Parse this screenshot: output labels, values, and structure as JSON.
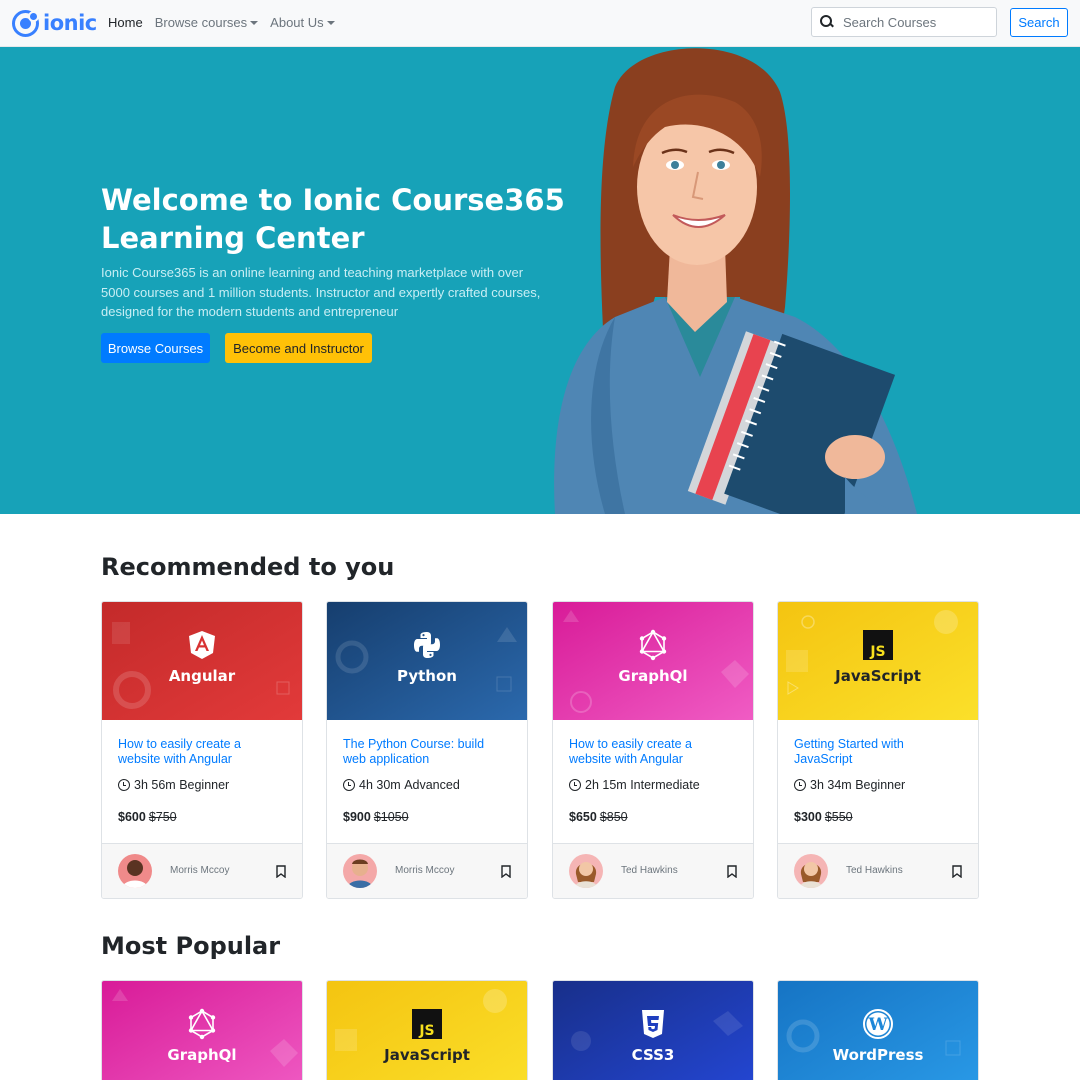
{
  "navbar": {
    "brand": "ionic",
    "links": [
      {
        "label": "Home",
        "active": true,
        "dropdown": false
      },
      {
        "label": "Browse courses",
        "active": false,
        "dropdown": true
      },
      {
        "label": "About Us",
        "active": false,
        "dropdown": true
      }
    ],
    "search": {
      "placeholder": "Search Courses",
      "value": ""
    },
    "search_button": "Search"
  },
  "hero": {
    "title": "Welcome to Ionic Course365 Learning Center",
    "text": "Ionic Course365 is an online learning and teaching marketplace with over 5000 courses and 1 million students. Instructor and expertly crafted courses, designed for the modern students and entrepreneur",
    "primary_button": "Browse Courses",
    "secondary_button": "Become and Instructor",
    "background": "#17a2b8"
  },
  "recommended": {
    "title": "Recommended to you",
    "cards": [
      {
        "image_label": "Angular",
        "icon": "angular-icon",
        "color": "#dd2c2c",
        "title": "How to easily create a website with Angular",
        "duration": "3h 56m",
        "level": "Beginner",
        "price": "$600",
        "old_price": "$750",
        "author": "Morris Mccoy"
      },
      {
        "image_label": "Python",
        "icon": "python-icon",
        "color": "#1e5594",
        "title": "The Python Course: build web application",
        "duration": "4h 30m",
        "level": "Advanced",
        "price": "$900",
        "old_price": "$1050",
        "author": "Morris Mccoy"
      },
      {
        "image_label": "GraphQl",
        "icon": "graphql-icon",
        "color": "#e535ab",
        "title": "How to easily create a website with Angular",
        "duration": "2h 15m",
        "level": "Intermediate",
        "price": "$650",
        "old_price": "$850",
        "author": "Ted Hawkins"
      },
      {
        "image_label": "JavaScript",
        "icon": "js-icon",
        "color": "#f7ce16",
        "title": "Getting Started with JavaScript",
        "duration": "3h 34m",
        "level": "Beginner",
        "price": "$300",
        "old_price": "$550",
        "author": "Ted Hawkins"
      }
    ]
  },
  "popular": {
    "title": "Most Popular",
    "cards": [
      {
        "image_label": "GraphQl",
        "icon": "graphql-icon",
        "color": "#e535ab"
      },
      {
        "image_label": "JavaScript",
        "icon": "js-icon",
        "color": "#f7ce16"
      },
      {
        "image_label": "CSS3",
        "icon": "css3-icon",
        "color": "#1f3fbf"
      },
      {
        "image_label": "WordPress",
        "icon": "wordpress-icon",
        "color": "#1d87d8"
      }
    ]
  }
}
